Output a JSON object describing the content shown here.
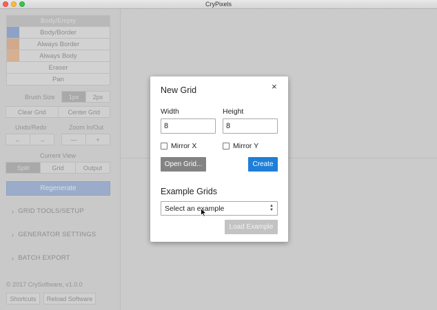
{
  "window": {
    "title": "CryPixels"
  },
  "sidebar": {
    "brushes": [
      {
        "label": "Body/Empty",
        "swatch": ""
      },
      {
        "label": "Body/Border",
        "swatch": "#8da2c6"
      },
      {
        "label": "Always Border",
        "swatch": "#d1a98d"
      },
      {
        "label": "Always Body",
        "swatch": "#d7b08f"
      },
      {
        "label": "Eraser",
        "swatch": ""
      },
      {
        "label": "Pan",
        "swatch": ""
      }
    ],
    "brush_size": {
      "label": "Brush Size",
      "options": [
        "1px",
        "2px"
      ],
      "selected": "1px"
    },
    "grid_actions": {
      "clear": "Clear Grid",
      "center": "Center Grid"
    },
    "undo_redo": {
      "label": "Undo/Redo",
      "undo_icon": "←",
      "redo_icon": "→"
    },
    "zoom": {
      "label": "Zoom In/Out",
      "out_icon": "—",
      "in_icon": "+"
    },
    "current_view": {
      "label": "Current View",
      "options": [
        "Split",
        "Grid",
        "Output"
      ],
      "selected": "Split"
    },
    "regenerate": "Regenerate",
    "sections": [
      "GRID TOOLS/SETUP",
      "GENERATOR SETTINGS",
      "BATCH EXPORT"
    ],
    "copyright": "© 2017 CrySoftware, v1.0.0",
    "footer_buttons": {
      "shortcuts": "Shortcuts",
      "reload": "Reload Software"
    }
  },
  "modal": {
    "title": "New Grid",
    "close_icon": "×",
    "width": {
      "label": "Width",
      "value": "8"
    },
    "height": {
      "label": "Height",
      "value": "8"
    },
    "mirror_x": {
      "label": "Mirror X",
      "checked": false
    },
    "mirror_y": {
      "label": "Mirror Y",
      "checked": false
    },
    "open_grid": "Open Grid...",
    "create": "Create",
    "example_title": "Example Grids",
    "example_select": {
      "value": "Select an example"
    },
    "load_example": "Load Example"
  },
  "colors": {
    "accent": "#1f7fd8",
    "open_grid": "#838383",
    "load_disabled": "#c3c3c3"
  }
}
